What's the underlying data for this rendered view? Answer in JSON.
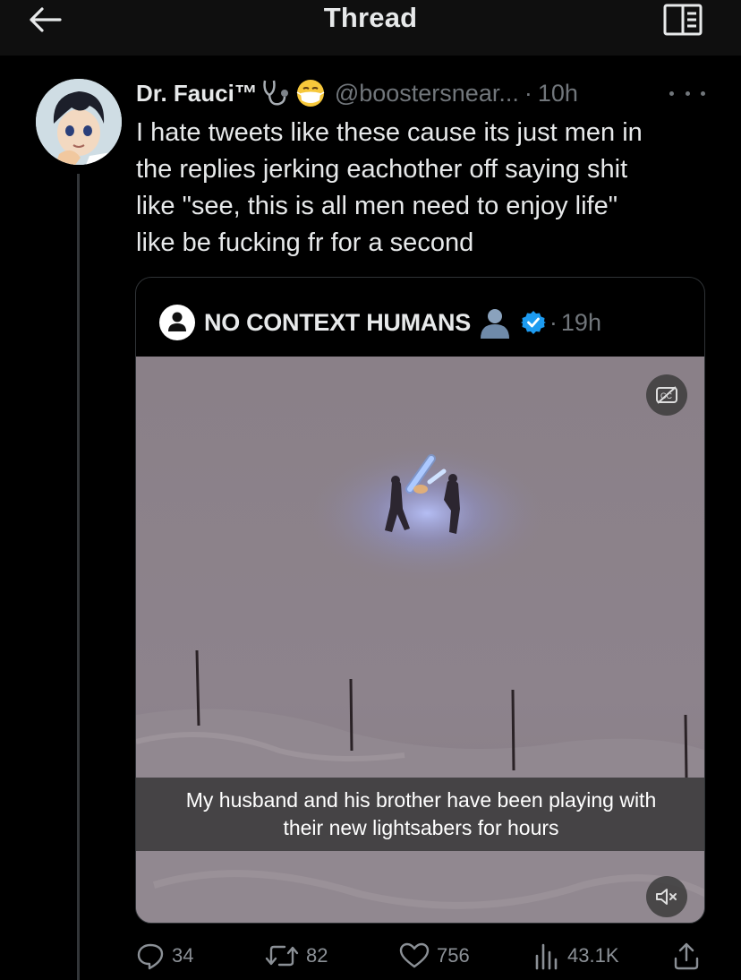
{
  "header": {
    "title": "Thread",
    "back_icon": "arrow-left-icon",
    "reader_icon": "reader-mode-icon"
  },
  "tweet": {
    "display_name": "Dr. Fauci™",
    "name_emojis": [
      "stethoscope",
      "face-with-medical-mask"
    ],
    "handle": "@boostersnear...",
    "separator": "·",
    "time": "10h",
    "text": "I hate tweets like these cause its just men in\nthe replies jerking eachother off saying shit\nlike \"see, this is all men need to enjoy life\"\nlike be fucking fr for a second",
    "more_icon": "more-dots-icon"
  },
  "quote": {
    "display_name": "NO CONTEXT HUMANS",
    "name_emoji": "bust-in-silhouette",
    "verified": true,
    "separator": "·",
    "time": "19h",
    "caption": "My husband and his brother have been playing with\ntheir new lightsabers for hours",
    "cc_icon": "captions-off-icon",
    "mute_icon": "volume-muted-icon"
  },
  "actions": {
    "replies": "34",
    "retweets": "82",
    "likes": "756",
    "views": "43.1K"
  },
  "colors": {
    "background": "#000000",
    "text": "#e7e9ea",
    "secondary": "#71767b",
    "verified": "#1d9bf0",
    "border": "#2f3336"
  }
}
